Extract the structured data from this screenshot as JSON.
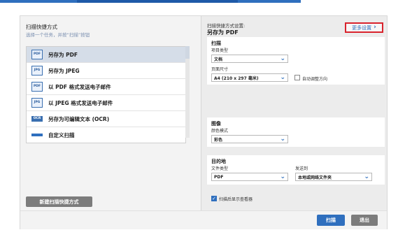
{
  "left_panel": {
    "title": "扫描快捷方式",
    "hint": "选择一个任务，并按“扫描”按钮",
    "shortcuts": [
      {
        "label": "另存为 PDF",
        "icon": "pdf-icon",
        "icon_text": "PDF"
      },
      {
        "label": "另存为 JPEG",
        "icon": "jpeg-icon",
        "icon_text": "JPG"
      },
      {
        "label": "以 PDF 格式发送电子邮件",
        "icon": "email-pdf-icon",
        "icon_text": "PDF"
      },
      {
        "label": "以 JPEG 格式发送电子邮件",
        "icon": "email-jpeg-icon",
        "icon_text": "JPG"
      },
      {
        "label": "另存为可编辑文本 (OCR)",
        "icon": "ocr-icon",
        "icon_text": "OCR"
      },
      {
        "label": "自定义扫描",
        "icon": "custom-scan-icon",
        "icon_text": ""
      }
    ],
    "new_shortcut_label": "新建扫描快捷方式"
  },
  "right_panel": {
    "settings_heading": "扫描快捷方式设置:",
    "shortcut_name": "另存为 PDF",
    "more_settings_label": "更多设置",
    "scan": {
      "title": "扫描",
      "item_type_label": "项目类型",
      "item_type_value": "文档",
      "page_size_label": "页面尺寸",
      "page_size_value": "A4 (210 x 297 毫米)",
      "auto_orient_label": "自动调整方向"
    },
    "image": {
      "title": "图像",
      "color_mode_label": "颜色模式",
      "color_mode_value": "彩色"
    },
    "destination": {
      "title": "目的地",
      "file_type_label": "文件类型",
      "file_type_value": "PDF",
      "send_to_label": "发送到",
      "send_to_value": "本地或网络文件夹"
    },
    "show_viewer_label": "扫描后显示查看器"
  },
  "footer": {
    "scan_label": "扫描",
    "exit_label": "退出"
  },
  "colors": {
    "accent": "#2f6fbe",
    "highlight_border": "#d9232d",
    "selected_row": "#d5dde8"
  }
}
